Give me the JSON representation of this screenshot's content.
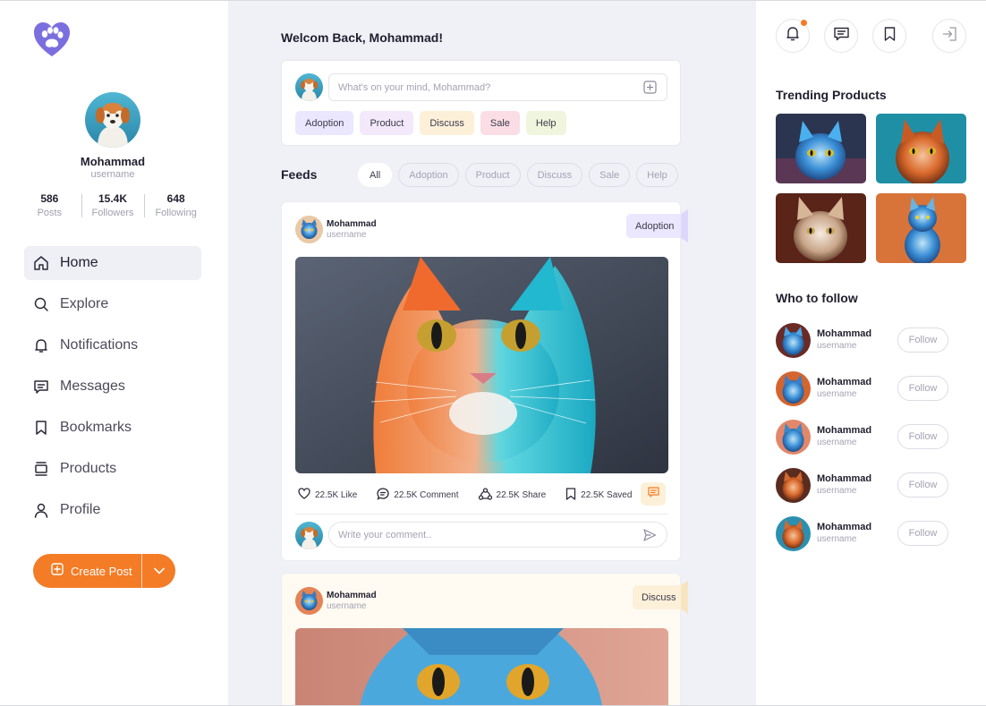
{
  "colors": {
    "accent": "#f47c26",
    "brand_purple": "#7b6fe0",
    "background_center": "#eff1f7"
  },
  "profile": {
    "name": "Mohammad",
    "username": "username",
    "stats": [
      {
        "value": "586",
        "label": "Posts"
      },
      {
        "value": "15.4K",
        "label": "Followers"
      },
      {
        "value": "648",
        "label": "Following"
      }
    ]
  },
  "nav": [
    {
      "label": "Home",
      "icon": "home-icon",
      "active": true
    },
    {
      "label": "Explore",
      "icon": "search-icon"
    },
    {
      "label": "Notifications",
      "icon": "bell-icon"
    },
    {
      "label": "Messages",
      "icon": "message-icon"
    },
    {
      "label": "Bookmarks",
      "icon": "bookmark-icon"
    },
    {
      "label": "Products",
      "icon": "products-icon"
    },
    {
      "label": "Profile",
      "icon": "user-icon"
    }
  ],
  "create_post": {
    "label": "Create Post"
  },
  "welcome": "Welcom Back, Mohammad!",
  "compose": {
    "placeholder": "What's on your mind, Mohammad?",
    "chips": [
      "Adoption",
      "Product",
      "Discuss",
      "Sale",
      "Help"
    ]
  },
  "feeds": {
    "title": "Feeds",
    "filters": [
      "All",
      "Adoption",
      "Product",
      "Discuss",
      "Sale",
      "Help"
    ],
    "active_filter": "All"
  },
  "posts": [
    {
      "name": "Mohammad",
      "username": "username",
      "tag": "Adoption",
      "actions": {
        "like": "22.5K Like",
        "comment": "22.5K Comment",
        "share": "22.5K Share",
        "saved": "22.5K Saved"
      },
      "comment_placeholder": "Write your comment.."
    },
    {
      "name": "Mohammad",
      "username": "username",
      "tag": "Discuss"
    }
  ],
  "right": {
    "trending_title": "Trending Products",
    "follow_title": "Who to follow",
    "follow": [
      {
        "name": "Mohammad",
        "username": "username",
        "button": "Follow"
      },
      {
        "name": "Mohammad",
        "username": "username",
        "button": "Follow"
      },
      {
        "name": "Mohammad",
        "username": "username",
        "button": "Follow"
      },
      {
        "name": "Mohammad",
        "username": "username",
        "button": "Follow"
      },
      {
        "name": "Mohammad",
        "username": "username",
        "button": "Follow"
      }
    ]
  }
}
